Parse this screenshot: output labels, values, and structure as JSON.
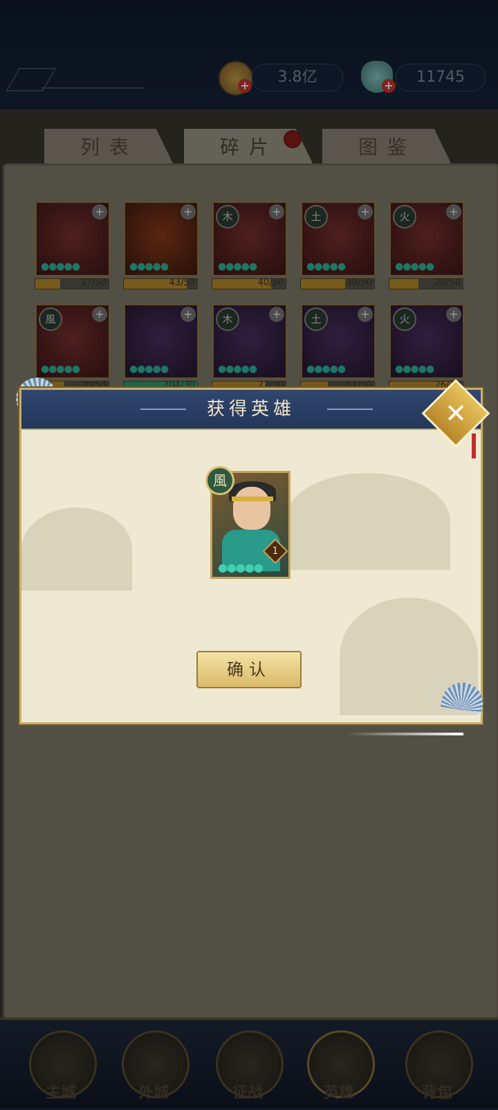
{
  "header": {
    "coins": "3.8亿",
    "jade": "11745",
    "add_symbol": "+"
  },
  "tabs": [
    "列表",
    "碎片",
    "图鉴"
  ],
  "active_tab": "碎片",
  "fragments": [
    {
      "element": "",
      "progress": "17/50",
      "ratio": 0.34,
      "color": "red"
    },
    {
      "element": "",
      "progress": "43/50",
      "ratio": 0.86,
      "color": "orange"
    },
    {
      "element": "木",
      "progress": "40/50",
      "ratio": 0.8,
      "color": "red"
    },
    {
      "element": "土",
      "progress": "30/50",
      "ratio": 0.6,
      "color": "red"
    },
    {
      "element": "火",
      "progress": "20/50",
      "ratio": 0.4,
      "color": "red"
    },
    {
      "element": "風",
      "progress": "20/50",
      "ratio": 0.4,
      "color": "red"
    },
    {
      "element": "",
      "progress": "204/30",
      "ratio": 1.0,
      "color": "purple"
    },
    {
      "element": "木",
      "progress": "22/30",
      "ratio": 0.73,
      "color": "purple"
    },
    {
      "element": "土",
      "progress": "11/30",
      "ratio": 0.37,
      "color": "purple"
    },
    {
      "element": "火",
      "progress": "26/30",
      "ratio": 0.87,
      "color": "purple"
    }
  ],
  "dialog": {
    "title": "获得英雄",
    "hero_element": "風",
    "hero_level": "1",
    "confirm": "确认",
    "close_symbol": "✕"
  },
  "nav": [
    "主城",
    "外城",
    "征战",
    "英雄",
    "背包"
  ],
  "colors": {
    "dialog_header": "#2a3c60",
    "gold_border": "#c9ad6a",
    "progress_fill": "#b88a2a",
    "star_teal": "#2fb59b"
  },
  "icons": {
    "coin": "coin-icon",
    "jade": "jade-icon",
    "close": "close-icon"
  }
}
